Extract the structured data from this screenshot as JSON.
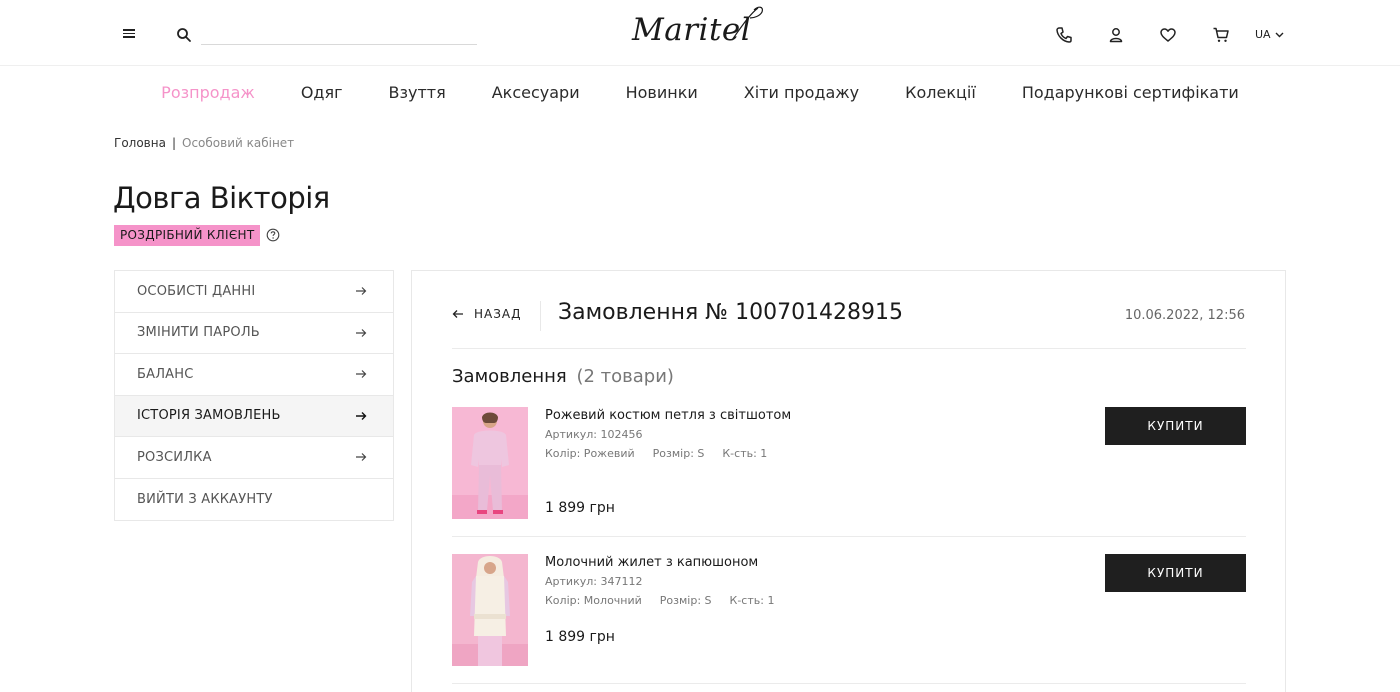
{
  "header": {
    "logo_text": "Maritel",
    "search_placeholder": "",
    "lang": "UA",
    "icons": [
      "menu-icon",
      "search-icon",
      "phone-icon",
      "user-icon",
      "heart-icon",
      "cart-icon",
      "chevron-down-icon"
    ]
  },
  "nav": {
    "items": [
      {
        "label": "Розпродаж"
      },
      {
        "label": "Одяг"
      },
      {
        "label": "Взуття"
      },
      {
        "label": "Аксесуари"
      },
      {
        "label": "Новинки"
      },
      {
        "label": "Хіти продажу"
      },
      {
        "label": "Колекції"
      },
      {
        "label": "Подарункові сертифікати"
      }
    ]
  },
  "breadcrumb": {
    "home": "Головна",
    "separator": "|",
    "current": "Особовий кабінет"
  },
  "profile": {
    "name": "Довга Вікторія",
    "badge": "РОЗДРІБНИЙ КЛІЄНТ"
  },
  "sidebar": {
    "items": [
      {
        "label": "ОСОБИСТІ ДАННІ"
      },
      {
        "label": "ЗМІНИТИ ПАРОЛЬ"
      },
      {
        "label": "БАЛАНС"
      },
      {
        "label": "ІСТОРІЯ ЗАМОВЛЕНЬ"
      },
      {
        "label": "РОЗСИЛКА"
      },
      {
        "label": "ВИЙТИ З АККАУНТУ"
      }
    ]
  },
  "order": {
    "back_label": "НАЗАД",
    "title": "Замовлення № 100701428915",
    "date": "10.06.2022, 12:56",
    "section_label": "Замовлення",
    "section_count": "(2 товари)",
    "products": [
      {
        "name": "Рожевий костюм петля з світшотом",
        "sku": "Артикул: 102456",
        "color": "Колір: Рожевий",
        "size": "Розмір: S",
        "qty": "К-сть: 1",
        "price": "1 899 грн",
        "buy_label": "КУПИТИ"
      },
      {
        "name": "Молочний жилет з капюшоном",
        "sku": "Артикул: 347112",
        "color": "Колір: Молочний",
        "size": "Розмір: S",
        "qty": "К-сть: 1",
        "price": "1 899 грн",
        "buy_label": "КУПИТИ"
      }
    ]
  },
  "colors": {
    "accent_pink": "#f593c9",
    "button_dark": "#1f1f1f",
    "border": "#e8e8e8"
  }
}
